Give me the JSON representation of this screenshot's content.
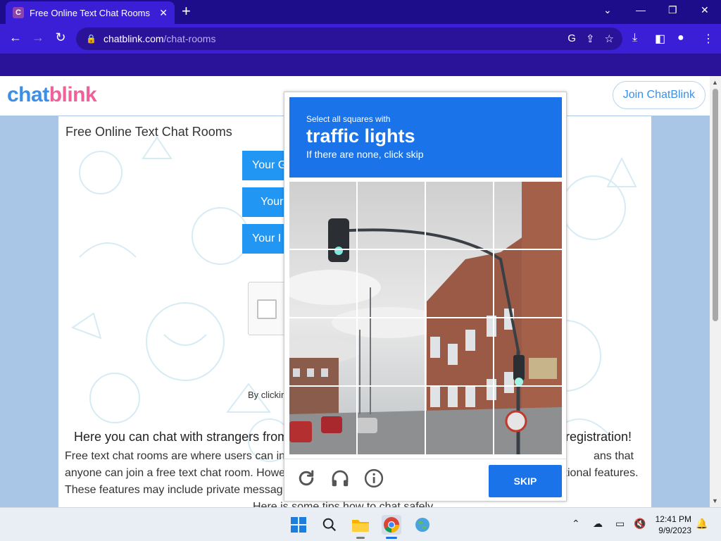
{
  "browser": {
    "tab_title": "Free Online Text Chat Rooms",
    "tab_favicon_letter": "C",
    "url_domain": "chatblink.com",
    "url_path": "/chat-rooms"
  },
  "site": {
    "logo_part1": "chat",
    "logo_part2": "blink",
    "join_button": "Join ChatBlink",
    "card_title": "Free Online Text Chat Rooms",
    "field1": "Your G",
    "field2": "Your",
    "field3": "Your I",
    "by_clicking": "By clickir",
    "heading_left": "Here you can chat with strangers from",
    "heading_right": "registration!",
    "para_line1_left": "Free text chat rooms are where users can in",
    "para_line1_right": "ans that",
    "para_line2_left": "anyone can join a free text chat room. Howe",
    "para_line2_right": "itional features.",
    "para_line3_left": "These features may include private messag",
    "tips_partial": "Here is some tips how to chat safely"
  },
  "captcha": {
    "instruction": "Select all squares with",
    "target": "traffic lights",
    "note": "If there are none, click skip",
    "skip_label": "SKIP",
    "reload_icon": "reload-icon",
    "audio_icon": "headphones-icon",
    "info_icon": "info-icon"
  },
  "taskbar": {
    "time": "12:41 PM",
    "date": "9/9/2023"
  },
  "colors": {
    "browser_frame": "#3b1fd6",
    "captcha_blue": "#1a73e8",
    "page_bg": "#a9c6e6",
    "logo_chat": "#3b8fe6",
    "logo_blink": "#f0609a"
  }
}
